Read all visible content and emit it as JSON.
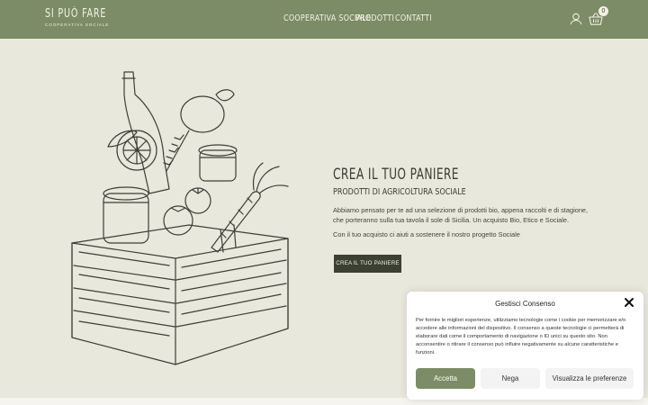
{
  "header": {
    "logo_text": "SI PUÒ FARE",
    "logo_subtitle": "COOPERATIVA SOCIALE",
    "nav": [
      {
        "label": "COOPERATIVA SOCIALE"
      },
      {
        "label": "PRODOTTI"
      },
      {
        "label": "CONTATTI"
      }
    ],
    "cart_count": "0",
    "user_icon": "user-icon",
    "cart_icon": "basket-icon"
  },
  "hero": {
    "title": "CREA IL TUO PANIERE",
    "subtitle": "PRODOTTI DI AGRICOLTURA SOCIALE",
    "description": "Abbiamo pensato per te ad una selezione di prodotti bio, appena raccolti e di stagione, che porteranno sulla tua tavola il sole di Sicilia. Un acquisto Bio, Etico e Sociale.",
    "description2": "Con il tuo acquisto ci aiuti a sostenere il nostro progetto Sociale",
    "cta_label": "CREA IL TUO PANIERE"
  },
  "consent": {
    "title": "Gestisci Consenso",
    "text": "Per fornire le migliori esperienze, utilizziamo tecnologie come i cookie per memorizzare e/o accedere alle informazioni del dispositivo. Il consenso a queste tecnologie ci permetterà di elaborare dati come il comportamento di navigazione o ID unici su questo sito. Non acconsentire o ritirare il consenso può influire negativamente su alcune caratteristiche e funzioni.",
    "accept_label": "Accetta",
    "deny_label": "Nega",
    "prefs_label": "Visualizza le preferenze"
  },
  "colors": {
    "header_bg": "#7c8c66",
    "page_bg": "#e8e8dc",
    "cta_bg": "#3c4033",
    "text_dark": "#3a3f33"
  }
}
